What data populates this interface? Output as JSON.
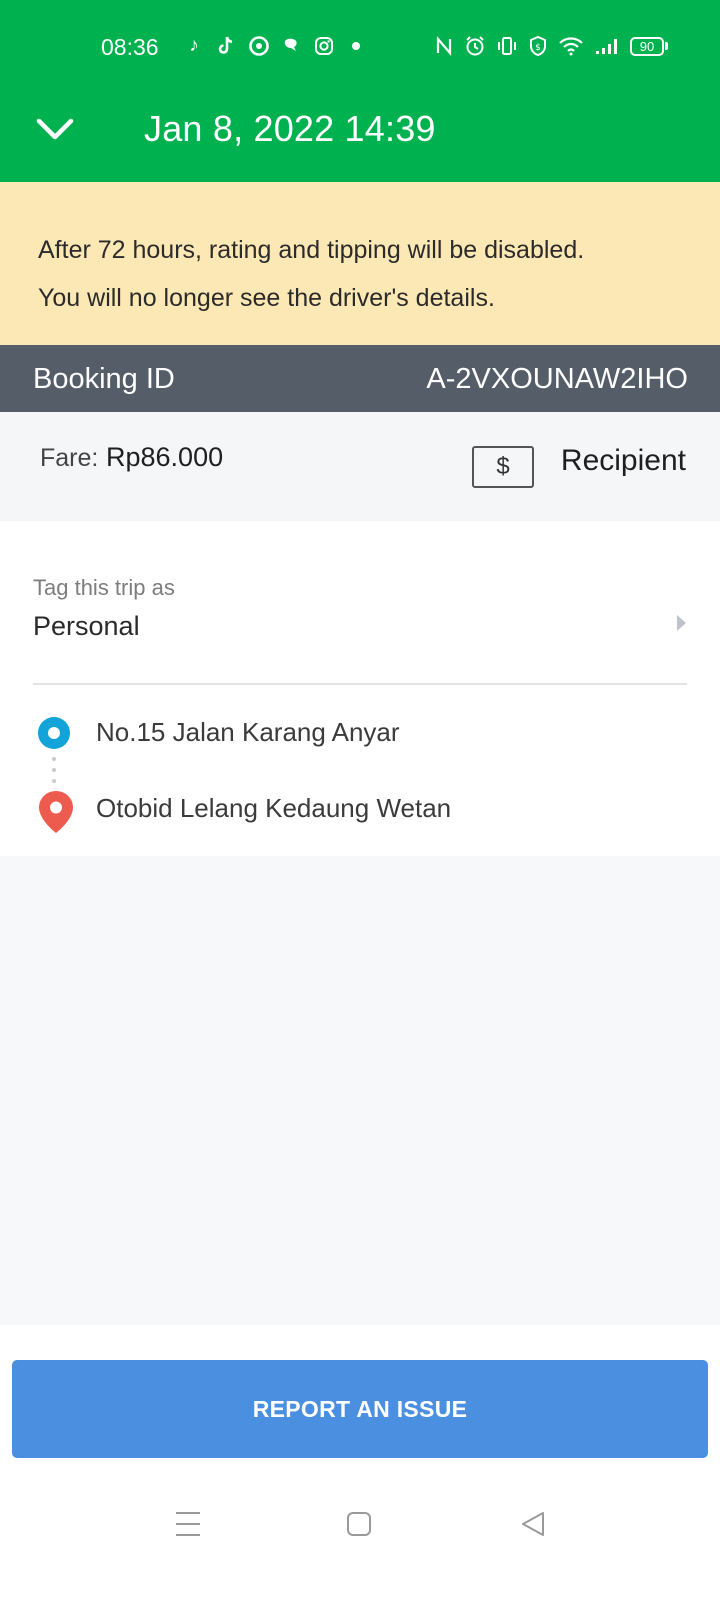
{
  "status_bar": {
    "time": "08:36",
    "battery_level": "90",
    "left_icons": [
      "music-note-icon",
      "tiktok-icon",
      "location-app-icon",
      "chat-app-icon",
      "instagram-icon",
      "notification-dot-icon"
    ],
    "right_icons": [
      "nfc-icon",
      "alarm-icon",
      "vibrate-icon",
      "vpn-shield-icon",
      "wifi-icon",
      "signal-icon"
    ]
  },
  "header": {
    "title": "Jan 8, 2022 14:39",
    "back_icon": "chevron-down-icon"
  },
  "notice": {
    "line1": "After 72 hours, rating and tipping will be disabled.",
    "line2": "You will no longer see the driver's details."
  },
  "booking": {
    "label": "Booking ID",
    "value": "A-2VXOUNAW2IHO"
  },
  "fare": {
    "label": "Fare:",
    "amount": "Rp86.000",
    "payment_symbol": "$",
    "payment_label": "Recipient"
  },
  "tag": {
    "label": "Tag this trip as",
    "value": "Personal"
  },
  "route": {
    "origin": "No.15 Jalan Karang Anyar",
    "destination": "Otobid Lelang Kedaung Wetan"
  },
  "actions": {
    "report_label": "REPORT AN ISSUE"
  },
  "colors": {
    "header_green": "#00b14f",
    "notice_yellow": "#fbe8b4",
    "booking_bar": "#555d69",
    "origin_blue": "#12a3d8",
    "destination_red": "#ec5b4d",
    "report_button": "#4a8fe0"
  }
}
